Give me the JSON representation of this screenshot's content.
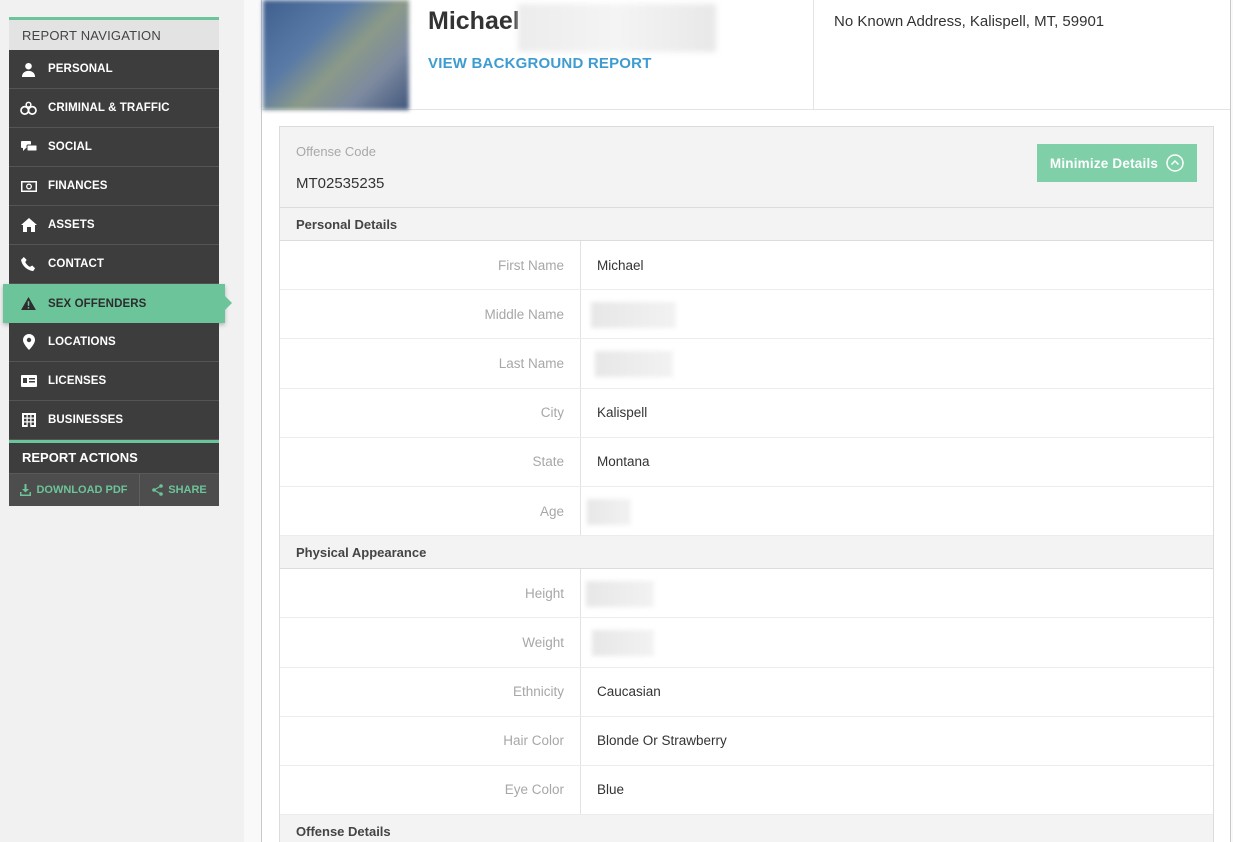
{
  "sidebar": {
    "nav_title": "REPORT NAVIGATION",
    "items": [
      {
        "label": "PERSONAL",
        "icon": "person-icon"
      },
      {
        "label": "CRIMINAL & TRAFFIC",
        "icon": "handcuffs-icon"
      },
      {
        "label": "SOCIAL",
        "icon": "chat-icon"
      },
      {
        "label": "FINANCES",
        "icon": "money-icon"
      },
      {
        "label": "ASSETS",
        "icon": "home-icon"
      },
      {
        "label": "CONTACT",
        "icon": "phone-icon"
      },
      {
        "label": "SEX OFFENDERS",
        "icon": "warning-icon",
        "active": true
      },
      {
        "label": "LOCATIONS",
        "icon": "map-pin-icon"
      },
      {
        "label": "LICENSES",
        "icon": "id-card-icon"
      },
      {
        "label": "BUSINESSES",
        "icon": "building-icon"
      }
    ],
    "actions_title": "REPORT ACTIONS",
    "download_label": "DOWNLOAD PDF",
    "share_label": "SHARE"
  },
  "header": {
    "first_name": "Michael",
    "view_link": "VIEW BACKGROUND REPORT",
    "address": "No Known Address, Kalispell, MT, 59901"
  },
  "record": {
    "offense_code_label": "Offense Code",
    "offense_code": "MT02535235",
    "minimize_label": "Minimize Details",
    "personal_title": "Personal Details",
    "personal": [
      {
        "label": "First Name",
        "value": "Michael"
      },
      {
        "label": "Middle Name",
        "value": ""
      },
      {
        "label": "Last Name",
        "value": ""
      },
      {
        "label": "City",
        "value": "Kalispell"
      },
      {
        "label": "State",
        "value": "Montana"
      },
      {
        "label": "Age",
        "value": ""
      }
    ],
    "physical_title": "Physical Appearance",
    "physical": [
      {
        "label": "Height",
        "value": ""
      },
      {
        "label": "Weight",
        "value": ""
      },
      {
        "label": "Ethnicity",
        "value": "Caucasian"
      },
      {
        "label": "Hair Color",
        "value": "Blonde Or Strawberry"
      },
      {
        "label": "Eye Color",
        "value": "Blue"
      }
    ],
    "offense_title": "Offense Details"
  },
  "colors": {
    "accent": "#6cc49a",
    "link": "#3e9cd0",
    "sidebar_bg": "#3d3d3d"
  }
}
